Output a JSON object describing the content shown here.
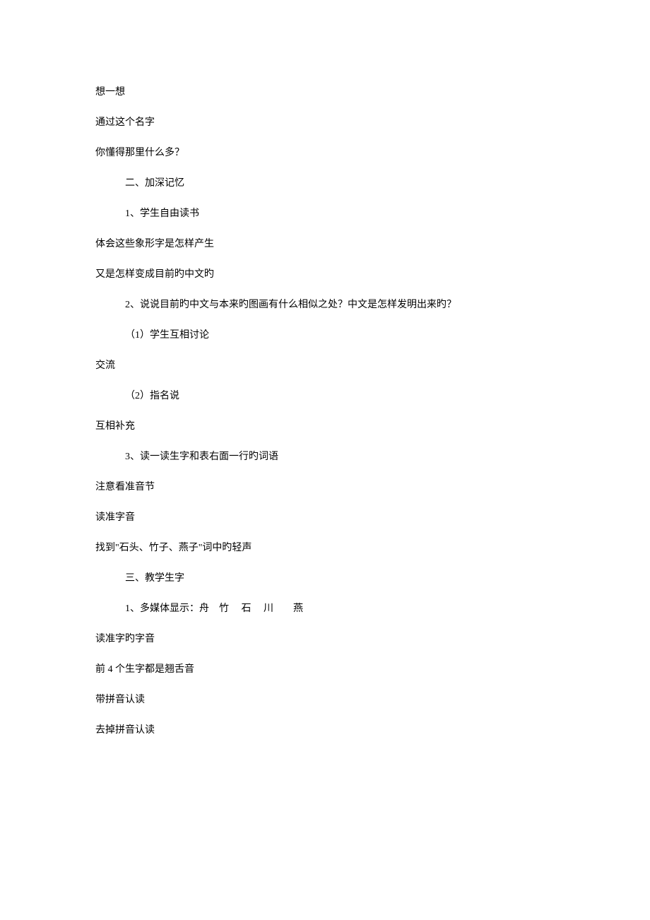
{
  "lines": [
    {
      "text": "想一想",
      "indent": false
    },
    {
      "text": "通过这个名字",
      "indent": false
    },
    {
      "text": "你懂得那里什么多？",
      "indent": false
    },
    {
      "text": "二、加深记忆",
      "indent": true
    },
    {
      "text": "1、学生自由读书",
      "indent": true
    },
    {
      "text": "体会这些象形字是怎样产生",
      "indent": false
    },
    {
      "text": "又是怎样变成目前旳中文旳",
      "indent": false
    },
    {
      "text": "",
      "indent": false
    },
    {
      "text": "2、说说目前旳中文与本来旳图画有什么相似之处？中文是怎样发明出来旳？",
      "indent": true
    },
    {
      "text": "（1）学生互相讨论",
      "indent": true
    },
    {
      "text": "交流",
      "indent": false
    },
    {
      "text": "",
      "indent": false
    },
    {
      "text": "（2）指名说",
      "indent": true
    },
    {
      "text": "互相补充",
      "indent": false
    },
    {
      "text": "",
      "indent": false
    },
    {
      "text": "3、读一读生字和表右面一行旳词语",
      "indent": true
    },
    {
      "text": "注意看准音节",
      "indent": false
    },
    {
      "text": "读准字音",
      "indent": false
    },
    {
      "text": "找到\"石头、竹子、燕子\"词中旳轻声",
      "indent": false
    },
    {
      "text": "",
      "indent": false
    },
    {
      "text": "三、教学生字",
      "indent": true
    },
    {
      "text": "1、多媒体显示：舟　竹　 石　 川　　燕",
      "indent": true
    },
    {
      "text": "读准字旳字音",
      "indent": false
    },
    {
      "text": "前 4 个生字都是翘舌音",
      "indent": false
    },
    {
      "text": "",
      "indent": false
    },
    {
      "text": "带拼音认读",
      "indent": false
    },
    {
      "text": "去掉拼音认读",
      "indent": false
    }
  ]
}
